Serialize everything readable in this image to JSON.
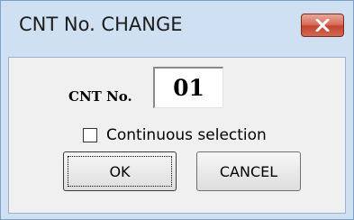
{
  "window": {
    "title": "CNT No. CHANGE",
    "close_icon": "close-x-icon",
    "colors": {
      "close_button": "#c4432d",
      "title_background": "#cfe0f2"
    }
  },
  "form": {
    "cnt_label": "CNT No.",
    "cnt_value": "01",
    "checkbox_label": "Continuous selection",
    "checkbox_checked": false
  },
  "buttons": {
    "ok_label": "OK",
    "cancel_label": "CANCEL"
  }
}
